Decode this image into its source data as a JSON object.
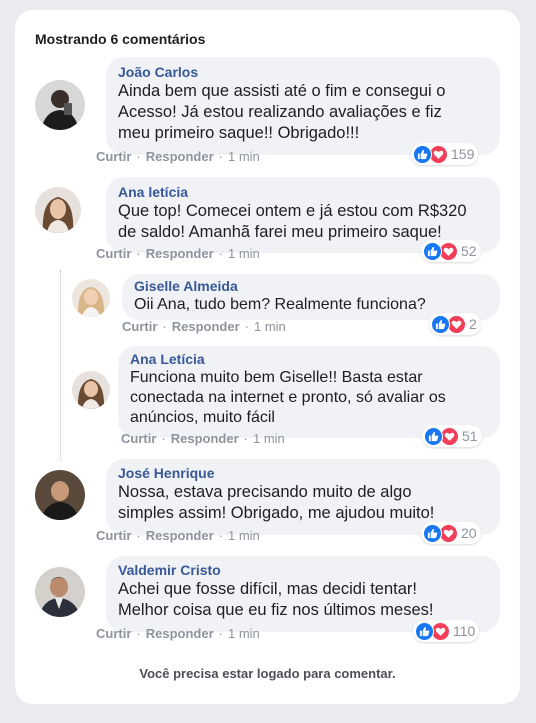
{
  "header": {
    "count_label": "Mostrando 6 comentários"
  },
  "actions": {
    "like": "Curtir",
    "reply": "Responder"
  },
  "comments": [
    {
      "author": "João Carlos",
      "lines": [
        "Ainda bem que assisti até o fim e consegui o",
        "Acesso! Já estou realizando avaliações e fiz",
        "meu primeiro saque!! Obrigado!!!"
      ],
      "time": "1 min",
      "reactions": "159"
    },
    {
      "author": "Ana letícia",
      "lines": [
        "Que top! Comecei ontem e já estou com R$320",
        "de saldo! Amanhã farei meu primeiro saque!"
      ],
      "time": "1 min",
      "reactions": "52"
    },
    {
      "author": "Giselle Almeida",
      "lines": [
        "Oii Ana, tudo bem? Realmente funciona?"
      ],
      "time": "1 min",
      "reactions": "2"
    },
    {
      "author": "Ana Letícia",
      "lines": [
        "Funciona muito bem Giselle!! Basta estar",
        "conectada na internet e pronto, só avaliar os",
        "anúncios, muito fácil"
      ],
      "time": "1 min",
      "reactions": "51"
    },
    {
      "author": "José Henrique",
      "lines": [
        "Nossa, estava precisando muito de algo",
        "simples assim! Obrigado, me ajudou muito!"
      ],
      "time": "1 min",
      "reactions": "20"
    },
    {
      "author": "Valdemir Cristo",
      "lines": [
        "Achei que fosse difícil, mas decidi tentar!",
        "Melhor coisa que eu fiz nos últimos meses!"
      ],
      "time": "1 min",
      "reactions": "110"
    }
  ],
  "footer": {
    "note": "Você precisa estar logado para comentar."
  },
  "colors": {
    "author": "#385898",
    "like": "#1877f2",
    "love": "#f33e58",
    "bubble": "#f0f2f5"
  },
  "icons": {
    "like": "thumbs-up-icon",
    "love": "heart-icon"
  }
}
